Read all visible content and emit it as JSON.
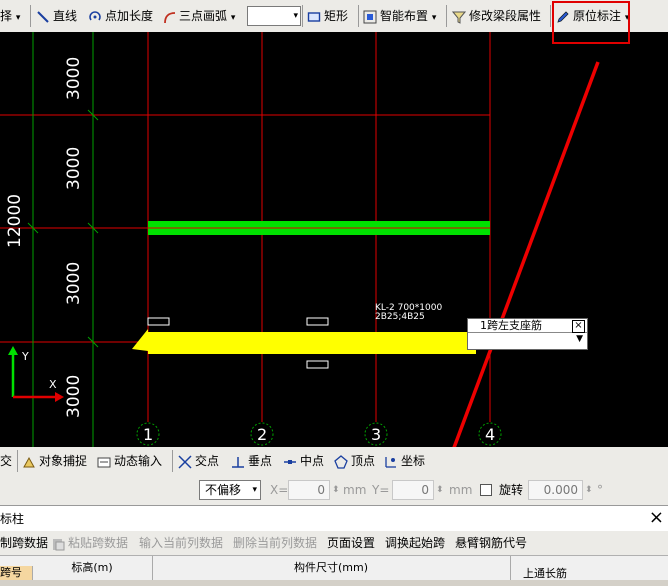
{
  "toolbar": {
    "select_partial": "择",
    "line": "直线",
    "point_length": "点加长度",
    "three_point_arc": "三点画弧",
    "rect": "矩形",
    "smart_layout": "智能布置",
    "modify_beam_props": "修改梁段属性",
    "in_situ_annotation": "原位标注"
  },
  "canvas": {
    "dims_left": [
      "3000",
      "3000",
      "3000",
      "3000"
    ],
    "total_dim": "12000",
    "axis_numbers": [
      "1",
      "2",
      "3",
      "4"
    ],
    "beam_label_line1": "KL-2 700*1000",
    "beam_label_line2": "2B25;4B25",
    "popup_title": "1跨左支座筋",
    "popup_close": "×",
    "ucs_y": "Y",
    "ucs_x": "X"
  },
  "snapbar": {
    "intersect_partial": "交",
    "object_snap": "对象捕捉",
    "dynamic_input": "动态输入",
    "intersection": "交点",
    "perpendicular": "垂点",
    "midpoint": "中点",
    "vertex": "顶点",
    "coordinate": "坐标"
  },
  "coordbar": {
    "offset_mode": "不偏移",
    "x_label": "X=",
    "x_value": "0",
    "x_unit": "mm",
    "y_label": "Y=",
    "y_value": "0",
    "y_unit": "mm",
    "rotate_label": "旋转",
    "rotate_value": "0.000",
    "rotate_unit": "°"
  },
  "panel": {
    "title_partial": "标柱",
    "close": "×",
    "actions": {
      "copy_span_partial": "制跨数据",
      "paste_span": "粘贴跨数据",
      "input_current_col": "输入当前列数据",
      "delete_current_col": "删除当前列数据",
      "page_setup": "页面设置",
      "swap_start_span": "调换起始跨",
      "cantilever_code": "悬臂钢筋代号"
    },
    "table_headers": {
      "span_no_partial": "跨号",
      "elevation": "标高(m)",
      "member_size": "构件尺寸(mm)",
      "top_through_bar": "上通长筋"
    }
  },
  "colors": {
    "canvas_bg": "#000000",
    "grid_red": "#e00000",
    "grid_green": "#00a000",
    "beam_green": "#00e000",
    "beam_yellow": "#ffff00",
    "annotation_red": "#e00000"
  }
}
